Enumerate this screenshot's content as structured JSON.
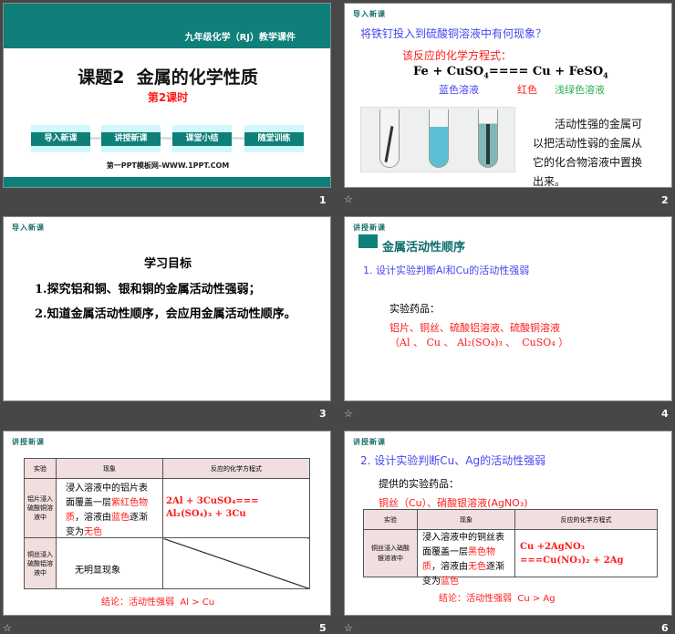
{
  "slides": [
    {
      "number": "1",
      "subtitle_top": "九年级化学（RJ）教学课件",
      "title": "课题2  金属的化学性质",
      "lesson": "第2课时",
      "nav": [
        "导入新课",
        "讲授新课",
        "课堂小结",
        "随堂训练"
      ],
      "footer": "第一PPT模板网-WWW.1PPT.COM"
    },
    {
      "number": "2",
      "section": "导入新课",
      "question": "将铁钉投入到硫酸铜溶液中有何现象？",
      "eq_label": "该反应的化学方程式：",
      "eq": {
        "a": "Fe + CuSO",
        "a_sub": "4",
        "b": "==== Cu + FeSO",
        "b_sub": "4"
      },
      "labels": [
        "蓝色溶液",
        "红色",
        "浅绿色溶液"
      ],
      "text": [
        "活动性强的金属可",
        "以把活动性弱的金属从",
        "它的化合物溶液中置换",
        "出来。"
      ]
    },
    {
      "number": "3",
      "section": "导入新课",
      "heading": "学习目标",
      "items": [
        "1.探究铝和铜、银和铜的金属活动性强弱；",
        "2.知道金属活动性顺序，会应用金属活动性顺序。"
      ]
    },
    {
      "number": "4",
      "section": "讲授新课",
      "title": "金属活动性顺序",
      "q": "1. 设计实验判断Al和Cu的活动性强弱",
      "drug_label": "实验药品：",
      "drugs": "铝片、铜丝、硫酸铝溶液、硫酸铜溶液",
      "formulas": "（Al 、 Cu 、 Al₂(SO₄)₃ 、  CuSO₄ ）"
    },
    {
      "number": "5",
      "section": "讲授新课",
      "headers": [
        "实验",
        "现象",
        "反应的化学方程式"
      ],
      "rows": [
        {
          "exp": "铝片浸入硫酸铜溶液中",
          "ph": [
            "浸入溶液中的铝片表面覆盖一层",
            "紫红色物质",
            "，溶液由",
            "蓝色",
            "逐渐变为",
            "无色"
          ],
          "eq": "2Al + 3CuSO₄=== Al₂(SO₄)₃ + 3Cu"
        },
        {
          "exp": "铜丝浸入硫酸铝溶液中",
          "ph": [
            "无明显现象"
          ],
          "eq": ""
        }
      ],
      "conclusion": "结论：活动性强弱  Al > Cu"
    },
    {
      "number": "6",
      "section": "讲授新课",
      "q": "2. 设计实验判断Cu、Ag的活动性强弱",
      "drug_label": "提供的实验药品：",
      "drugs": "铜丝（Cu）、硝酸银溶液(AgNO₃)",
      "headers": [
        "实验",
        "现象",
        "反应的化学方程式"
      ],
      "row": {
        "exp": "铜丝浸入硝酸银溶液中",
        "ph": [
          "浸入溶液中的铜丝表面覆盖一层",
          "黑色物质",
          "，溶液由",
          "无色",
          "逐渐变为",
          "蓝色"
        ],
        "eq": "Cu +2AgNO₃ ===Cu(NO₃)₂ + 2Ag"
      },
      "conclusion": "结论：活动性强弱  Cu > Ag"
    }
  ],
  "star_icon": "☆"
}
